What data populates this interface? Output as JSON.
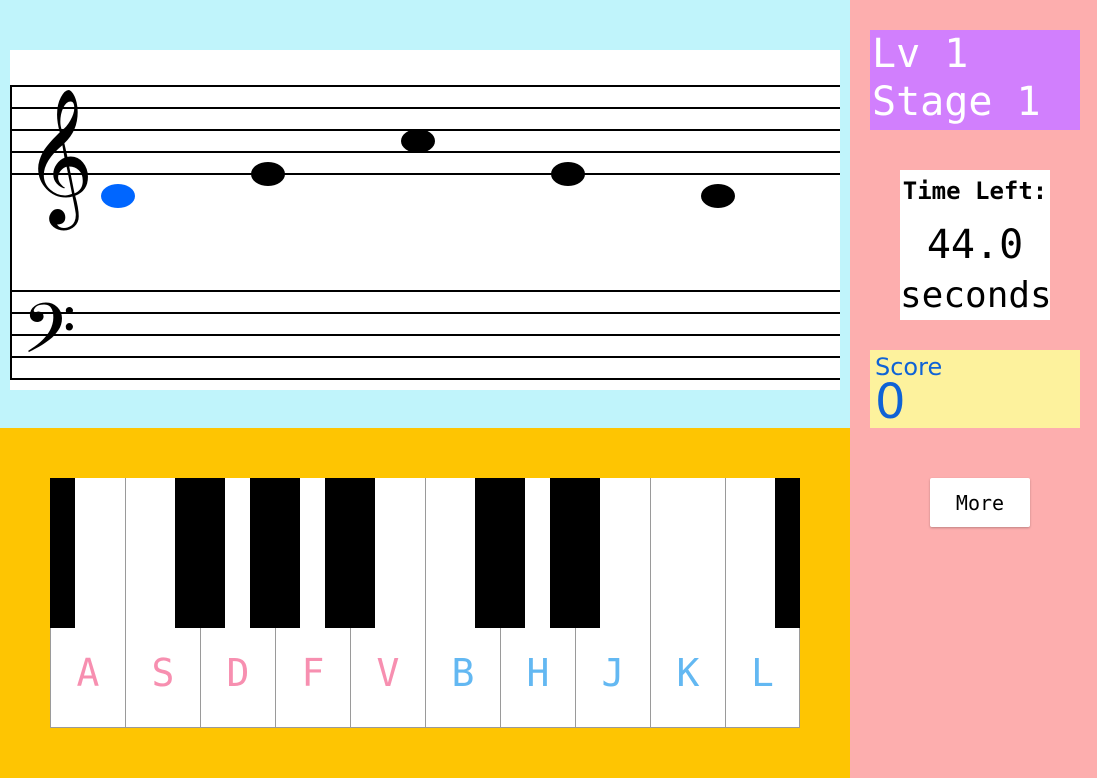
{
  "staff": {
    "clefs": [
      "treble-clef",
      "bass-clef"
    ],
    "notes": [
      {
        "pitch": "C4",
        "state": "current"
      },
      {
        "pitch": "E4",
        "state": "pending"
      },
      {
        "pitch": "A4",
        "state": "pending"
      },
      {
        "pitch": "E4",
        "state": "pending"
      },
      {
        "pitch": "C4",
        "state": "pending"
      }
    ],
    "colors": {
      "current": "#0066ff",
      "pending": "#000000",
      "background": "#c0f4fb"
    }
  },
  "keyboard": {
    "white_keys": [
      {
        "letter": "A",
        "color": "#f78fb0"
      },
      {
        "letter": "S",
        "color": "#f78fb0"
      },
      {
        "letter": "D",
        "color": "#f78fb0"
      },
      {
        "letter": "F",
        "color": "#f78fb0"
      },
      {
        "letter": "V",
        "color": "#f78fb0"
      },
      {
        "letter": "B",
        "color": "#63b8f2"
      },
      {
        "letter": "H",
        "color": "#63b8f2"
      },
      {
        "letter": "J",
        "color": "#63b8f2"
      },
      {
        "letter": "K",
        "color": "#63b8f2"
      },
      {
        "letter": "L",
        "color": "#63b8f2"
      }
    ],
    "background": "#fec502"
  },
  "sidebar": {
    "level": "Lv 1",
    "stage": "Stage 1",
    "timer_label": "Time Left:",
    "timer_value": "44.0",
    "timer_unit": "seconds",
    "score_label": "Score",
    "score_value": "0",
    "more_label": "More"
  }
}
